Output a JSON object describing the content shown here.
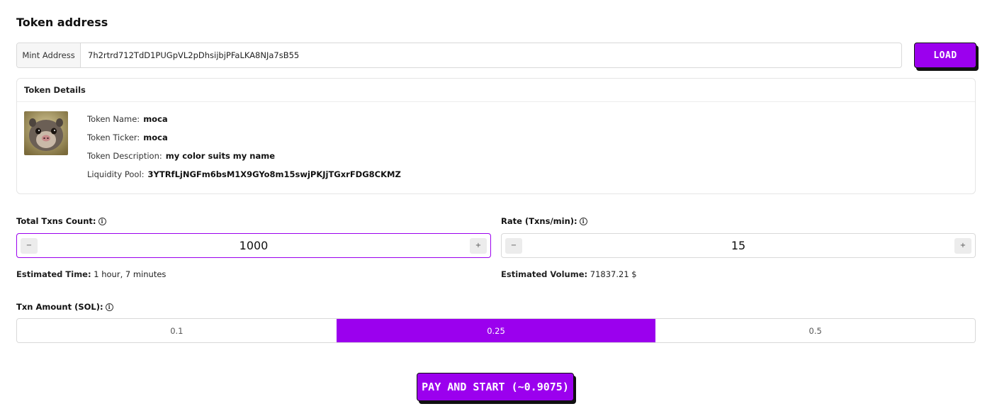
{
  "section_title": "Token address",
  "mint": {
    "label": "Mint Address",
    "value": "7h2rtrd712TdD1PUGpVL2pDhsijbjPFaLKA8NJa7sB55",
    "load_label": "LOAD"
  },
  "details": {
    "header": "Token Details",
    "rows": [
      {
        "key": "Token Name:",
        "value": "moca"
      },
      {
        "key": "Token Ticker:",
        "value": "moca"
      },
      {
        "key": "Token Description:",
        "value": "my color suits my name"
      },
      {
        "key": "Liquidity Pool:",
        "value": "3YTRfLjNGFm6bsM1X9GYo8m15swjPKJjTGxrFDG8CKMZ"
      }
    ]
  },
  "total_txns": {
    "label": "Total Txns Count:",
    "value": "1000",
    "minus": "−",
    "plus": "+"
  },
  "rate": {
    "label": "Rate (Txns/min):",
    "value": "15",
    "minus": "−",
    "plus": "+"
  },
  "estimated_time": {
    "label": "Estimated Time:",
    "value": "1 hour, 7 minutes"
  },
  "estimated_volume": {
    "label": "Estimated Volume:",
    "value": "71837.21 $"
  },
  "txn_amount": {
    "label": "Txn Amount (SOL):",
    "options": [
      "0.1",
      "0.25",
      "0.5"
    ],
    "selected": "0.25"
  },
  "pay_button": "PAY AND START (~0.9075)",
  "colors": {
    "accent": "#9b00ee"
  },
  "icons": {
    "info": "info-icon"
  }
}
